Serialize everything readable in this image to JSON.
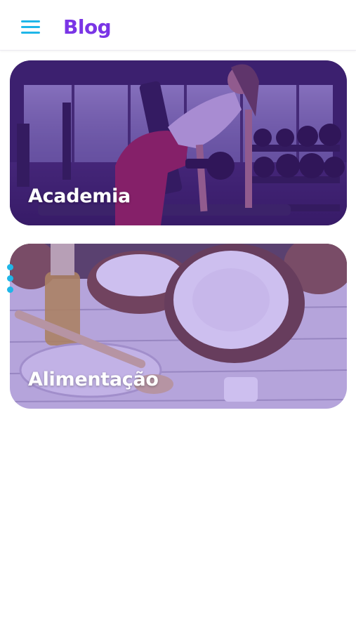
{
  "header": {
    "title": "Blog",
    "menu_icon": "hamburger-menu-icon",
    "accent_color": "#7a35e6",
    "icon_color": "#1fb6e8"
  },
  "cards": [
    {
      "label": "Academia",
      "image": "gym-woman-dumbbell-photo",
      "overlay_color": "#521ca8"
    },
    {
      "label": "Alimentação",
      "image": "coconut-oil-photo",
      "overlay_color": "#7850d2"
    }
  ],
  "indicator": {
    "icon": "vertical-dots-indicator",
    "color": "#1fb6e8"
  }
}
